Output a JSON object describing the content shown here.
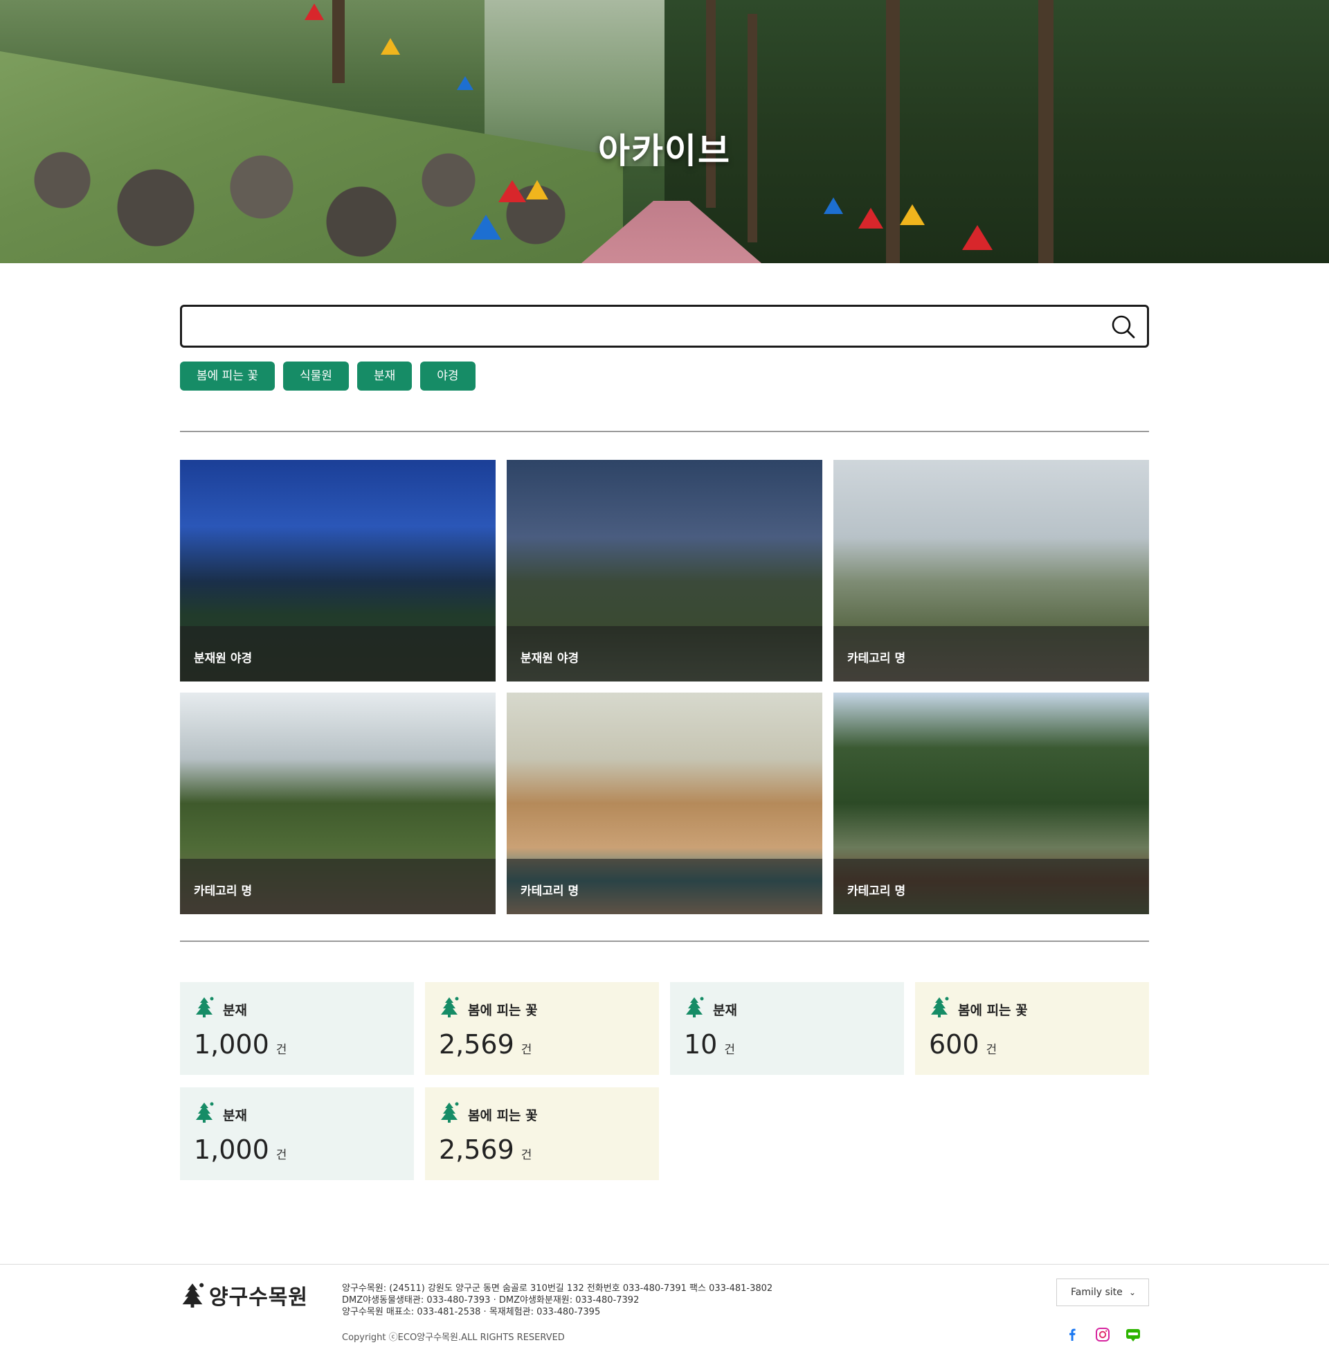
{
  "hero": {
    "title": "아카이브"
  },
  "search": {
    "placeholder": "",
    "value": ""
  },
  "tags": [
    "봄에 피는 꽃",
    "식물원",
    "분재",
    "야경"
  ],
  "gallery": [
    {
      "caption": "분재원 야경"
    },
    {
      "caption": "분재원 야경"
    },
    {
      "caption": "카테고리 명"
    },
    {
      "caption": "카테고리 명"
    },
    {
      "caption": "카테고리 명"
    },
    {
      "caption": "카테고리 명"
    }
  ],
  "stats": [
    {
      "label": "분재",
      "count": "1,000",
      "unit": "건"
    },
    {
      "label": "봄에 피는 꽃",
      "count": "2,569",
      "unit": "건"
    },
    {
      "label": "분재",
      "count": "10",
      "unit": "건"
    },
    {
      "label": "봄에 피는 꽃",
      "count": "600",
      "unit": "건"
    },
    {
      "label": "분재",
      "count": "1,000",
      "unit": "건"
    },
    {
      "label": "봄에 피는 꽃",
      "count": "2,569",
      "unit": "건"
    }
  ],
  "footer": {
    "logo_text": "양구수목원",
    "info_line1": "양구수목원: (24511) 강원도 양구군 동면 숨골로 310번길 132 전화번호 033-480-7391 팩스 033-481-3802",
    "info_line2": "DMZ야생동물생태관: 033-480-7393 · DMZ야생화분재원: 033-480-7392",
    "info_line3": "양구수목원 매표소: 033-481-2538 · 목재체험관: 033-480-7395",
    "copyright": "Copyright ⓒECO양구수목원.ALL RIGHTS RESERVED",
    "family_site": "Family site",
    "sns": [
      "facebook-icon",
      "instagram-icon",
      "blog-icon"
    ]
  },
  "colors": {
    "accent": "#168c66",
    "mint_card": "#edf4f2",
    "cream_card": "#f8f6e5"
  }
}
